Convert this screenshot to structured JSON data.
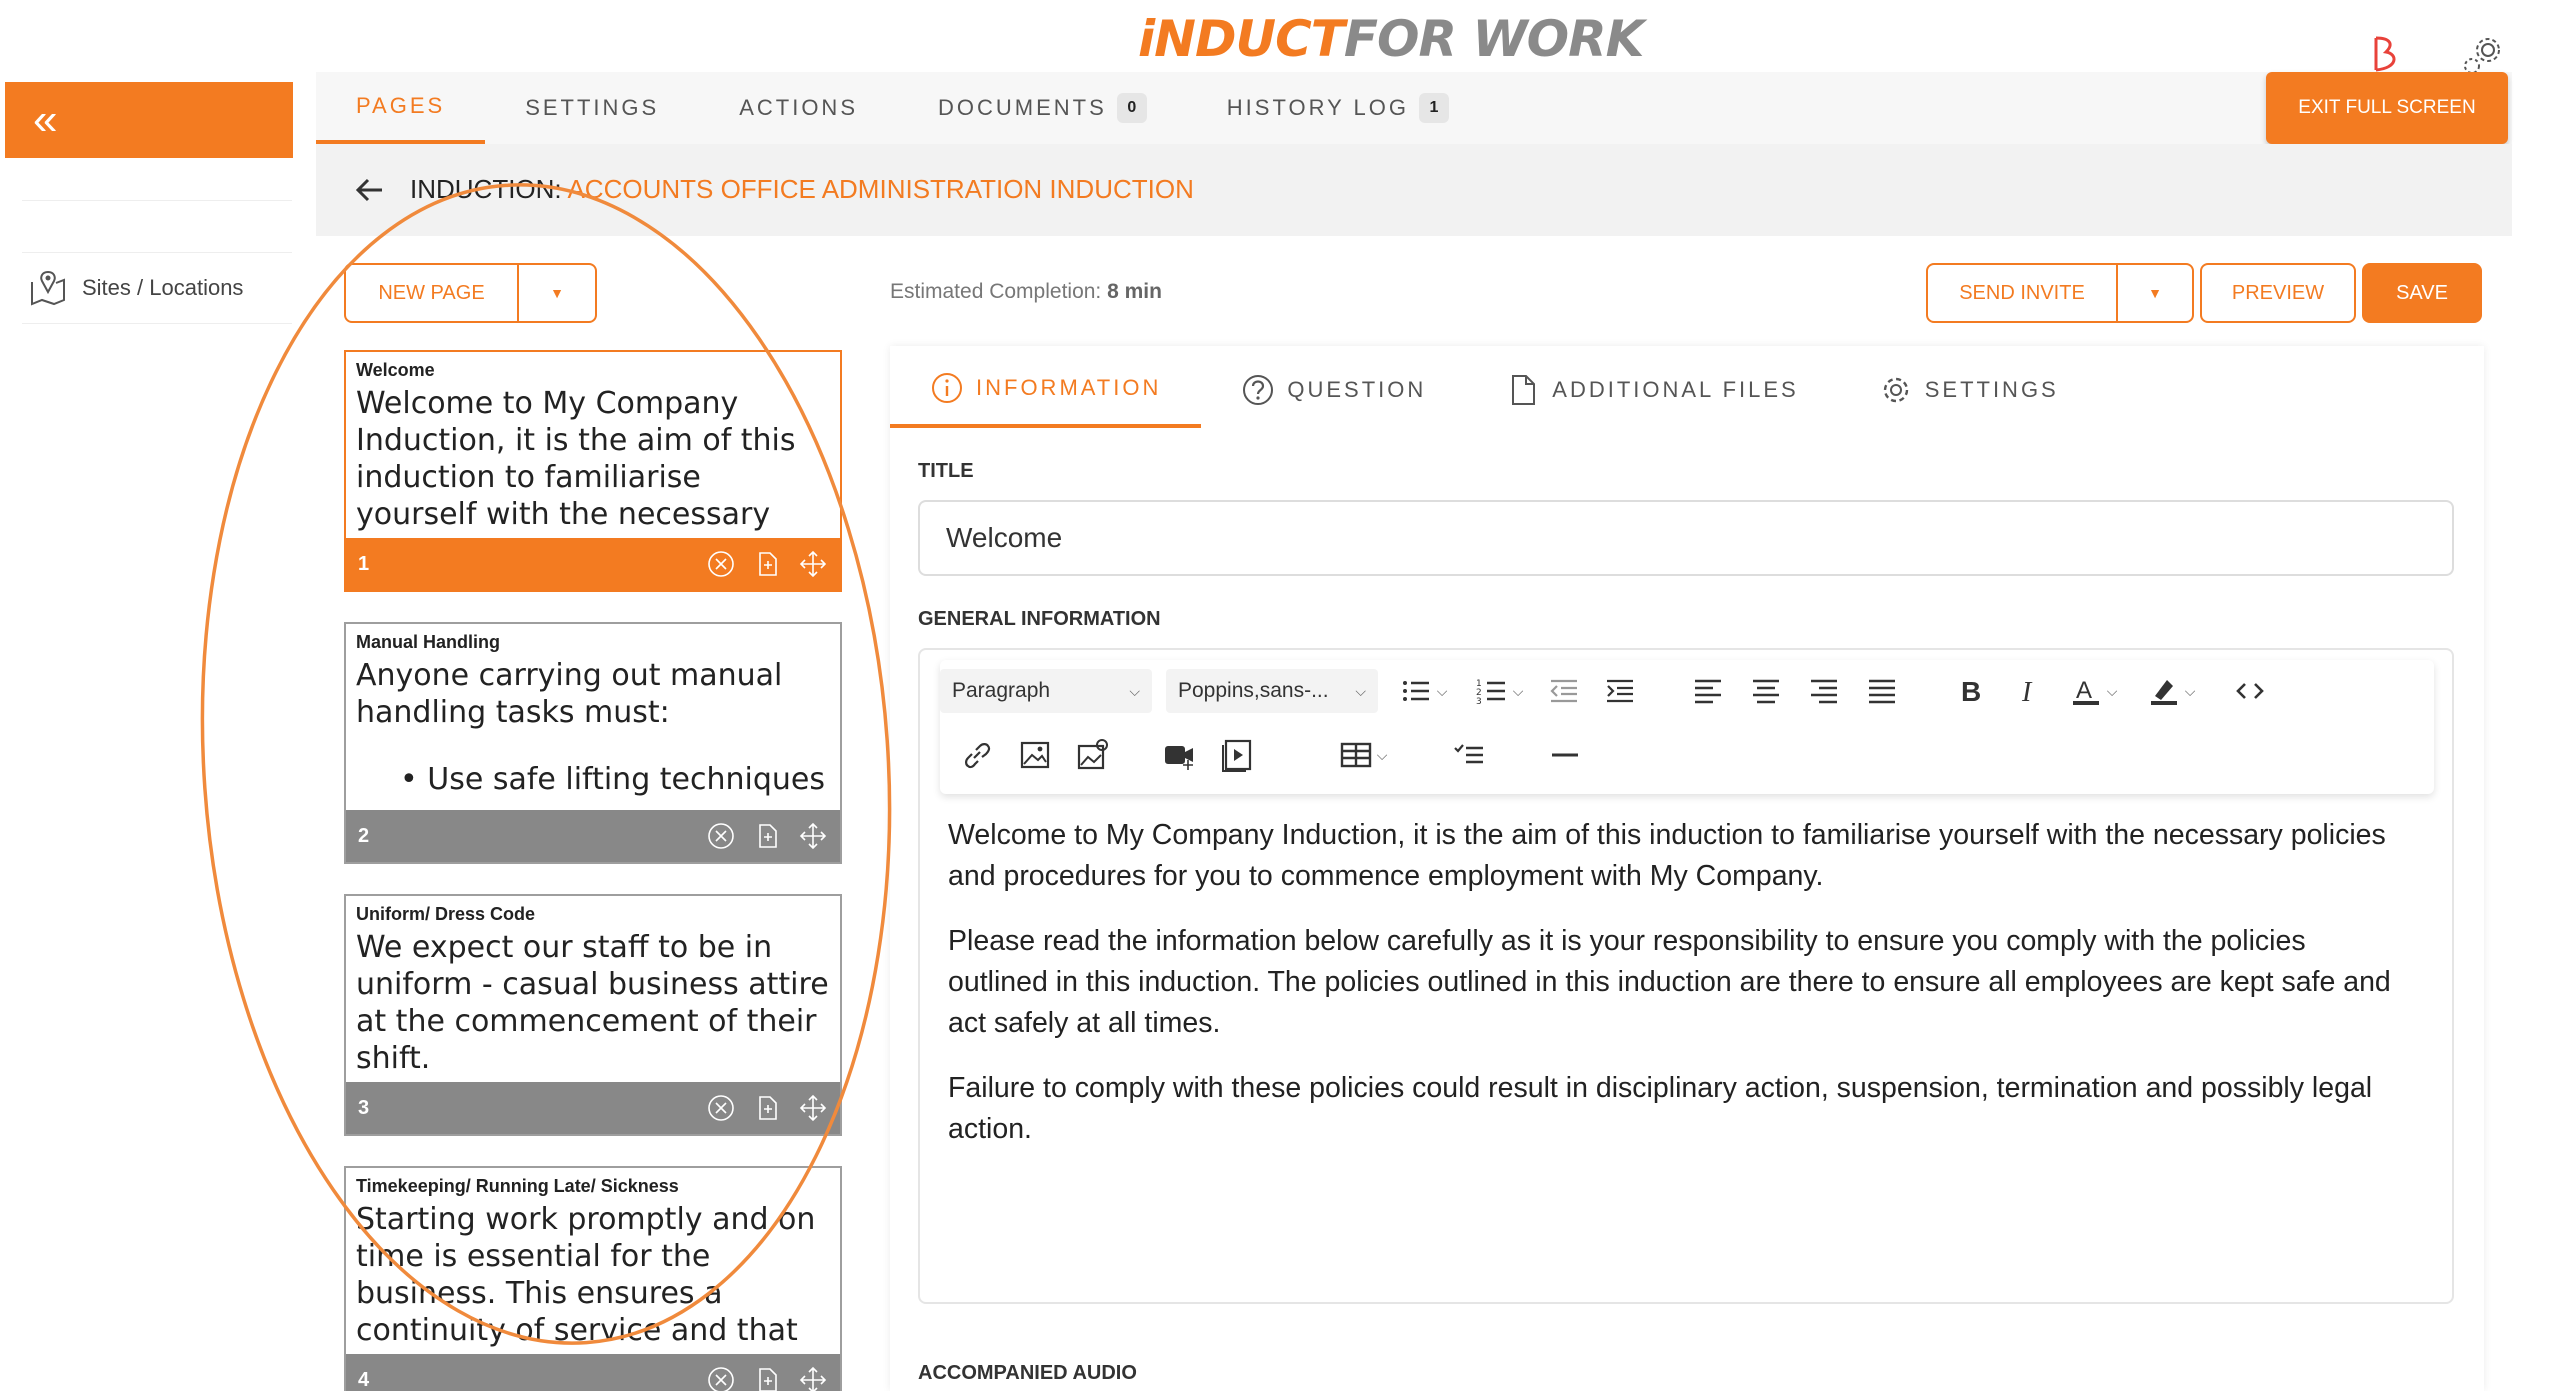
{
  "brand": {
    "logo_part1": "iNDUCT",
    "logo_part2": "FOR WORK",
    "accent": "#f37b21"
  },
  "sidebar": {
    "collapse_glyph": "«",
    "items": [
      {
        "label": "Sites / Locations",
        "icon": "map-pin-icon"
      }
    ]
  },
  "top_tabs": [
    {
      "label": "PAGES"
    },
    {
      "label": "SETTINGS"
    },
    {
      "label": "ACTIONS"
    },
    {
      "label": "DOCUMENTS",
      "badge": "0"
    },
    {
      "label": "HISTORY LOG",
      "badge": "1"
    }
  ],
  "exit_button": "EXIT FULL SCREEN",
  "induction": {
    "prefix": "INDUCTION: ",
    "name": "ACCOUNTS OFFICE ADMINISTRATION INDUCTION"
  },
  "new_page_button": "NEW PAGE",
  "estimated": {
    "label": "Estimated Completion: ",
    "value": "8 min"
  },
  "actions": {
    "send_invite": "SEND INVITE",
    "preview": "PREVIEW",
    "save": "SAVE"
  },
  "pages": [
    {
      "title": "Welcome",
      "text": "Welcome to My Company Induction, it is the aim of this induction to familiarise yourself with the necessary policies and procedures for you",
      "number": "1"
    },
    {
      "title": "Manual Handling",
      "text": "Anyone carrying out manual handling tasks must:",
      "bullet": "Use safe lifting techniques",
      "number": "2"
    },
    {
      "title": "Uniform/ Dress Code",
      "text": "We expect our staff to be in uniform - casual business attire at the commencement of their shift.",
      "number": "3"
    },
    {
      "title": "Timekeeping/ Running Late/ Sickness",
      "text": "Starting work promptly and on time is essential for the business. This ensures a continuity of service and that the work is finished in time",
      "number": "4"
    }
  ],
  "editor_tabs": [
    {
      "label": "INFORMATION",
      "icon": "info-icon"
    },
    {
      "label": "QUESTION",
      "icon": "question-icon"
    },
    {
      "label": "ADDITIONAL FILES",
      "icon": "file-icon"
    },
    {
      "label": "SETTINGS",
      "icon": "gear-icon"
    }
  ],
  "form": {
    "title_label": "TITLE",
    "title_value": "Welcome",
    "general_label": "GENERAL INFORMATION",
    "audio_label": "ACCOMPANIED AUDIO"
  },
  "toolbar": {
    "block_format": "Paragraph",
    "font_family": "Poppins,sans-..."
  },
  "content": {
    "p1": "Welcome to My Company Induction, it is the aim of this induction to familiarise yourself with the necessary policies and procedures for you to commence employment with My Company.",
    "p2": "Please read the information below carefully as it is your responsibility to ensure you comply with the policies outlined in this induction. The policies outlined in this induction are there to ensure all employees are kept safe and act safely at all times.",
    "p3": "Failure to comply with these policies could result in disciplinary action, suspension, termination and possibly legal action."
  }
}
